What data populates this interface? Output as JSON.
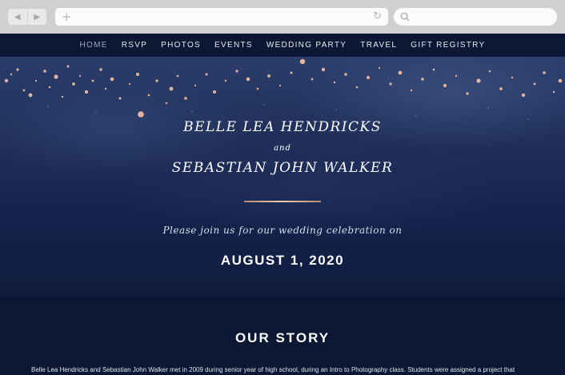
{
  "browser": {
    "back_icon": "back-arrow-icon",
    "forward_icon": "forward-arrow-icon",
    "new_tab_icon": "plus-icon",
    "reload_icon": "reload-icon",
    "search_icon": "search-icon"
  },
  "nav": {
    "items": [
      {
        "label": "HOME",
        "active": true
      },
      {
        "label": "RSVP"
      },
      {
        "label": "PHOTOS"
      },
      {
        "label": "EVENTS"
      },
      {
        "label": "WEDDING PARTY"
      },
      {
        "label": "TRAVEL"
      },
      {
        "label": "GIFT REGISTRY"
      }
    ]
  },
  "hero": {
    "name1": "BELLE LEA HENDRICKS",
    "and": "and",
    "name2": "SEBASTIAN JOHN WALKER",
    "invite": "Please join us for our wedding celebration on",
    "date": "AUGUST 1, 2020"
  },
  "story": {
    "title": "OUR STORY",
    "text": "Belle Lea Hendricks and Sebastian John Walker met in 2009 during senior year of high school, during an Intro to Photography class. Students were assigned a project that"
  },
  "colors": {
    "page_bg": "#0c1a35",
    "nav_bg": "#0c1833",
    "accent_rose_gold": "#e3b59c"
  }
}
